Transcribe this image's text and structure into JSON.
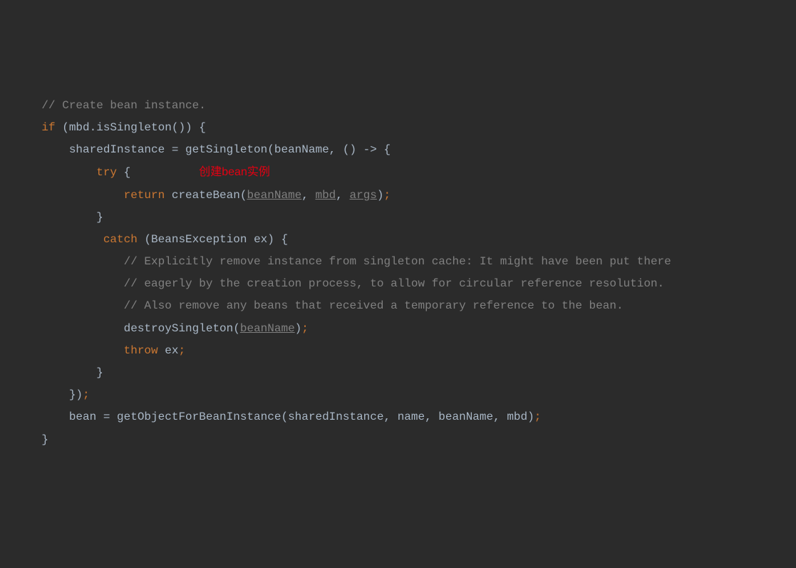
{
  "code": {
    "line1_comment": "// Create bean instance.",
    "line2_if": "if",
    "line2_cond": " (mbd.isSingleton()) {",
    "line3_lhs": "sharedInstance = getSingleton(beanName, () -> {",
    "line4_try": "try",
    "line4_brace": " {",
    "line4_annotation": "创建bean实例",
    "line5_return": "return",
    "line5_method": " createBean(",
    "line5_arg1": "beanName",
    "line5_comma1": ", ",
    "line5_arg2": "mbd",
    "line5_comma2": ", ",
    "line5_arg3": "args",
    "line5_close": ")",
    "line5_semi": ";",
    "line6_brace": "}",
    "line7_catch": "catch",
    "line7_rest": " (BeansException ex) {",
    "line8_comment": "// Explicitly remove instance from singleton cache: It might have been put there",
    "line9_comment": "// eagerly by the creation process, to allow for circular reference resolution.",
    "line10_comment": "// Also remove any beans that received a temporary reference to the bean.",
    "line11_method": "destroySingleton(",
    "line11_arg": "beanName",
    "line11_close": ")",
    "line11_semi": ";",
    "line12_throw": "throw",
    "line12_var": " ex",
    "line12_semi": ";",
    "line13_brace": "}",
    "line14_close": "})",
    "line14_semi": ";",
    "line15_assign": "bean = getObjectForBeanInstance(sharedInstance, name, beanName, mbd)",
    "line15_semi": ";",
    "line16_brace": "}"
  }
}
